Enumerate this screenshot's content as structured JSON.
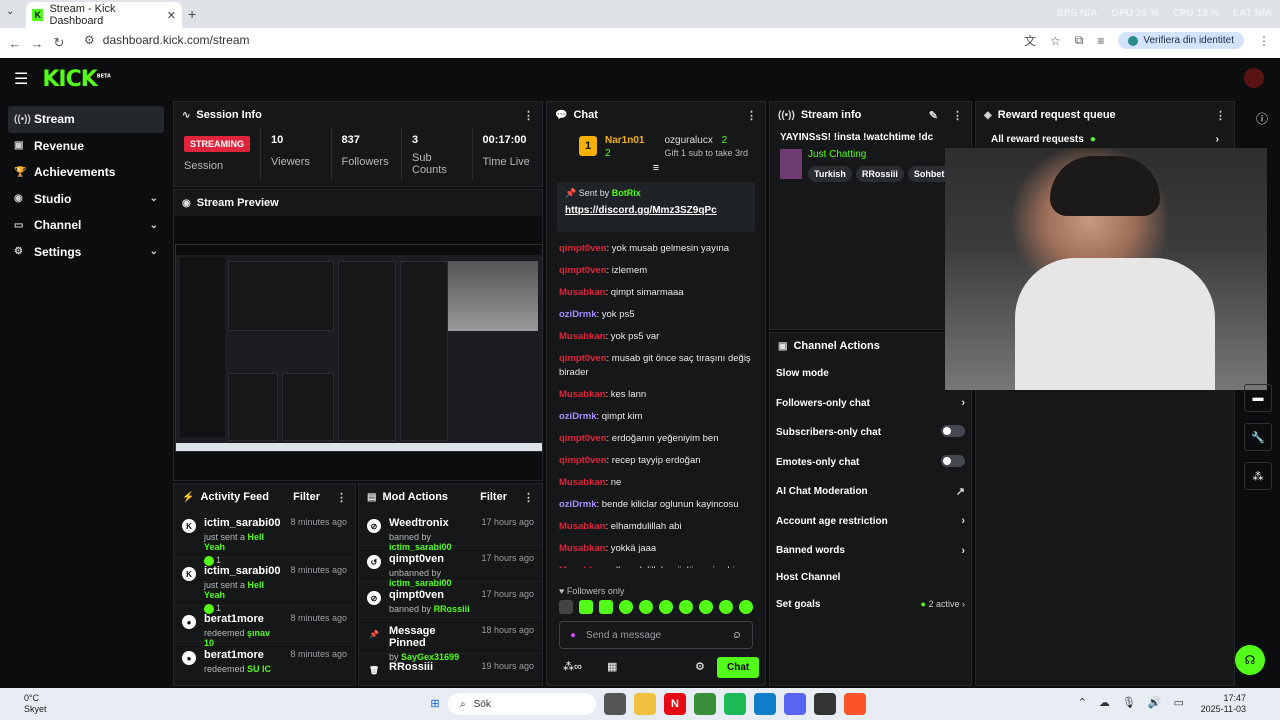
{
  "browser": {
    "tab_title": "Stream - Kick Dashboard",
    "url": "dashboard.kick.com/stream",
    "verify_label": "Verifiera din identitet",
    "sysmon": [
      "BPS N/A",
      "GPU 30 %",
      "CPU 13 %",
      "LAT N/A"
    ]
  },
  "brand": {
    "logo": "KICK",
    "beta": "BETA",
    "accent": "#53fc18"
  },
  "sidebar": {
    "items": [
      {
        "label": "Stream",
        "icon": "stream-icon"
      },
      {
        "label": "Revenue",
        "icon": "revenue-icon"
      },
      {
        "label": "Achievements",
        "icon": "trophy-icon"
      },
      {
        "label": "Studio",
        "icon": "studio-icon"
      },
      {
        "label": "Channel",
        "icon": "channel-icon"
      },
      {
        "label": "Settings",
        "icon": "settings-icon"
      }
    ]
  },
  "session": {
    "title": "Session Info",
    "status": "STREAMING",
    "status_label": "Session",
    "stats": [
      {
        "value": "10",
        "label": "Viewers"
      },
      {
        "value": "837",
        "label": "Followers"
      },
      {
        "value": "3",
        "label": "Sub Counts"
      },
      {
        "value": "00:17:00",
        "label": "Time Live"
      }
    ]
  },
  "preview": {
    "title": "Stream Preview"
  },
  "activity": {
    "title": "Activity Feed",
    "filter": "Filter",
    "items": [
      {
        "name": "ictim_sarabi00",
        "text": "just sent a",
        "item": "Hell Yeah",
        "count": "1",
        "time": "8 minutes ago"
      },
      {
        "name": "ictim_sarabi00",
        "text": "just sent a",
        "item": "Hell Yeah",
        "count": "1",
        "time": "8 minutes ago"
      },
      {
        "name": "berat1more",
        "text": "redeemed",
        "item": "şınav 10",
        "count": "",
        "time": "8 minutes ago"
      },
      {
        "name": "berat1more",
        "text": "redeemed",
        "item": "SU IC",
        "count": "",
        "time": "8 minutes ago"
      }
    ]
  },
  "mod": {
    "title": "Mod Actions",
    "filter": "Filter",
    "items": [
      {
        "name": "Weedtronix",
        "text": "banned by",
        "by": "ictim_sarabi00",
        "time": "17 hours ago"
      },
      {
        "name": "qimpt0ven",
        "text": "unbanned by",
        "by": "ictim_sarabi00",
        "time": "17 hours ago"
      },
      {
        "name": "qimpt0ven",
        "text": "banned by",
        "by": "RRossiii",
        "time": "17 hours ago"
      },
      {
        "name": "Message Pinned",
        "text": "by",
        "by": "SayGex31699",
        "time": "18 hours ago"
      },
      {
        "name": "RRossiii",
        "text": "",
        "by": "",
        "time": "19 hours ago"
      }
    ]
  },
  "chat": {
    "title": "Chat",
    "leader1": "Nar1n01",
    "leader1_count": "2",
    "leader2": "ozguralucx",
    "leader2_count": "2",
    "gift_text": "Gift 1 sub to take 3rd",
    "pinned_by_label": "Sent by",
    "pinned_by": "BotRix",
    "pinned_link": "https://discord.gg/Mmz3SZ9qPc",
    "messages": [
      {
        "user": "qimpt0ven",
        "text": "yok musab gelmesin yayına",
        "c": "u1"
      },
      {
        "user": "qimpt0ven",
        "text": "izlemem",
        "c": "u1"
      },
      {
        "user": "Musabkan",
        "text": "qimpt simarmaaa",
        "c": "u3"
      },
      {
        "user": "oziDrmk",
        "text": "yok ps5",
        "c": "u2"
      },
      {
        "user": "Musabkan",
        "text": "yok ps5 var",
        "c": "u3"
      },
      {
        "user": "qimpt0ven",
        "text": "musab git önce saç tıraşını değiş birader",
        "c": "u1"
      },
      {
        "user": "Musabkan",
        "text": "kes lann",
        "c": "u3"
      },
      {
        "user": "oziDrmk",
        "text": "qimpt kim",
        "c": "u2"
      },
      {
        "user": "qimpt0ven",
        "text": "erdoğanın yeğeniyim ben",
        "c": "u1"
      },
      {
        "user": "qimpt0ven",
        "text": "recep tayyip erdoğan",
        "c": "u1"
      },
      {
        "user": "Musabkan",
        "text": "ne",
        "c": "u3"
      },
      {
        "user": "oziDrmk",
        "text": "bende kiliclar oglunun kayincosu",
        "c": "u2"
      },
      {
        "user": "Musabkan",
        "text": "elhamdulillah abi",
        "c": "u3"
      },
      {
        "user": "Musabkan",
        "text": "yokkä jaaa",
        "c": "u3"
      },
      {
        "user": "Musabkan",
        "text": "elhamdulillah müslümaniz abi o yüzden elhamdulliah dedim",
        "c": "u3"
      }
    ],
    "followers_only": "Followers only",
    "placeholder": "Send a message",
    "send": "Chat"
  },
  "stream_info": {
    "title": "Stream info",
    "stream_title": "YAYINSsS! !insta !watchtime !dc",
    "category": "Just Chatting",
    "tags": [
      "Turkish",
      "RRossiii",
      "Sohbet"
    ]
  },
  "channel_actions": {
    "title": "Channel Actions",
    "items": [
      {
        "label": "Slow mode",
        "right": ""
      },
      {
        "label": "Followers-only chat",
        "right": "›"
      },
      {
        "label": "Subscribers-only chat",
        "right": "toggle"
      },
      {
        "label": "Emotes-only chat",
        "right": "toggle"
      },
      {
        "label": "AI Chat Moderation",
        "right": "↗"
      },
      {
        "label": "Account age restriction",
        "right": "›"
      },
      {
        "label": "Banned words",
        "right": "›"
      },
      {
        "label": "Host Channel",
        "right": ""
      },
      {
        "label": "Set goals",
        "right": "2 active ›"
      }
    ]
  },
  "rewards": {
    "title": "Reward request queue",
    "all": "All reward requests"
  },
  "taskbar": {
    "temp": "0°C",
    "weather": "Skyet",
    "search": "Sök",
    "time": "17:47",
    "date": "2025-11-03"
  }
}
